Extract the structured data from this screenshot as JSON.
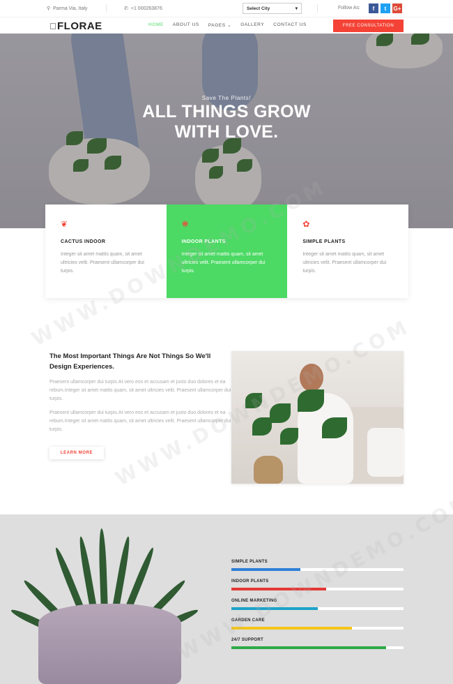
{
  "topbar": {
    "location": "Parma Via, Italy",
    "phone": "+1 000263876",
    "city_select": "Select City",
    "follow_label": "Follow As:",
    "social": [
      {
        "name": "facebook",
        "glyph": "f",
        "color": "#3b5998"
      },
      {
        "name": "twitter",
        "glyph": "t",
        "color": "#1da1f2"
      },
      {
        "name": "google-plus",
        "glyph": "G+",
        "color": "#dd4b39"
      }
    ]
  },
  "navbar": {
    "logo": "FLORAE",
    "items": [
      {
        "label": "HOME",
        "active": true
      },
      {
        "label": "ABOUT US",
        "active": false
      },
      {
        "label": "PAGES",
        "active": false,
        "has_dropdown": true
      },
      {
        "label": "GALLERY",
        "active": false
      },
      {
        "label": "CONTACT US",
        "active": false
      }
    ],
    "cta": "FREE CONSULTATION"
  },
  "hero": {
    "subtitle": "Save The Plants!",
    "title_line1": "ALL THINGS GROW",
    "title_line2": "WITH LOVE."
  },
  "features": [
    {
      "title": "CACTUS INDOOR",
      "text": "Integer sit amet mattis quam, sit amet ultricies velit. Praesent ullamcorper dui turpis.",
      "highlight": false,
      "icon": "leaf-icon"
    },
    {
      "title": "INDOOR PLANTS",
      "text": "Integer sit amet mattis quam, sit amet ultricies velit. Praesent ullamcorper dui turpis.",
      "highlight": true,
      "icon": "flower-icon"
    },
    {
      "title": "SIMPLE PLANTS",
      "text": "Integer sit amet mattis quam, sit amet ultricies velit. Praesent ullamcorper dui turpis.",
      "highlight": false,
      "icon": "bow-icon"
    }
  ],
  "about": {
    "title": "The Most Important Things Are Not Things So We'll Design Experiences.",
    "para1": "Praesent ullamcorper dui turpis.At vero eos et accusam et justo duo dolores et ea rebum.Integer sit amet mattis quam, sit amet ultricies velit. Praesent ullamcorper dui turpis.",
    "para2": "Praesent ullamcorper dui turpis.At vero eos et accusam et justo duo dolores et ea rebum.Integer sit amet mattis quam, sit amet ultricies velit. Praesent ullamcorper dui turpis.",
    "button": "LEARN MORE"
  },
  "skills": [
    {
      "label": "SIMPLE PLANTS",
      "percent": 40,
      "color": "#2f7fd6"
    },
    {
      "label": "INDOOR PLANTS",
      "percent": 55,
      "color": "#e53935"
    },
    {
      "label": "ONLINE MARKETING",
      "percent": 50,
      "color": "#1fa2c9"
    },
    {
      "label": "GARDEN CARE",
      "percent": 70,
      "color": "#f5c518"
    },
    {
      "label": "24/7 SUPPORT",
      "percent": 90,
      "color": "#2eaa47"
    }
  ],
  "colors": {
    "accent_green": "#4cd964",
    "accent_red": "#f44336"
  }
}
